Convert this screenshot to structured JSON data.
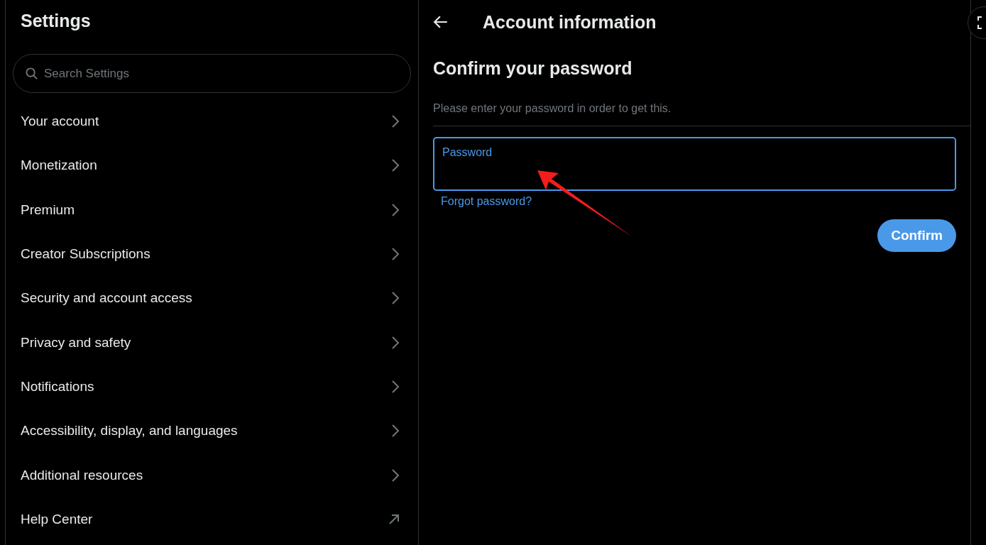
{
  "sidebar": {
    "title": "Settings",
    "search": {
      "placeholder": "Search Settings"
    },
    "items": [
      {
        "label": "Your account",
        "kind": "section"
      },
      {
        "label": "Monetization",
        "kind": "section"
      },
      {
        "label": "Premium",
        "kind": "section"
      },
      {
        "label": "Creator Subscriptions",
        "kind": "section"
      },
      {
        "label": "Security and account access",
        "kind": "section"
      },
      {
        "label": "Privacy and safety",
        "kind": "section"
      },
      {
        "label": "Notifications",
        "kind": "section"
      },
      {
        "label": "Accessibility, display, and languages",
        "kind": "section"
      },
      {
        "label": "Additional resources",
        "kind": "section"
      },
      {
        "label": "Help Center",
        "kind": "external"
      }
    ]
  },
  "main": {
    "title": "Account information",
    "heading": "Confirm your password",
    "description": "Please enter your password in order to get this.",
    "password_field": {
      "label": "Password",
      "focused": true
    },
    "forgot_link": "Forgot password?",
    "confirm_button": "Confirm"
  }
}
